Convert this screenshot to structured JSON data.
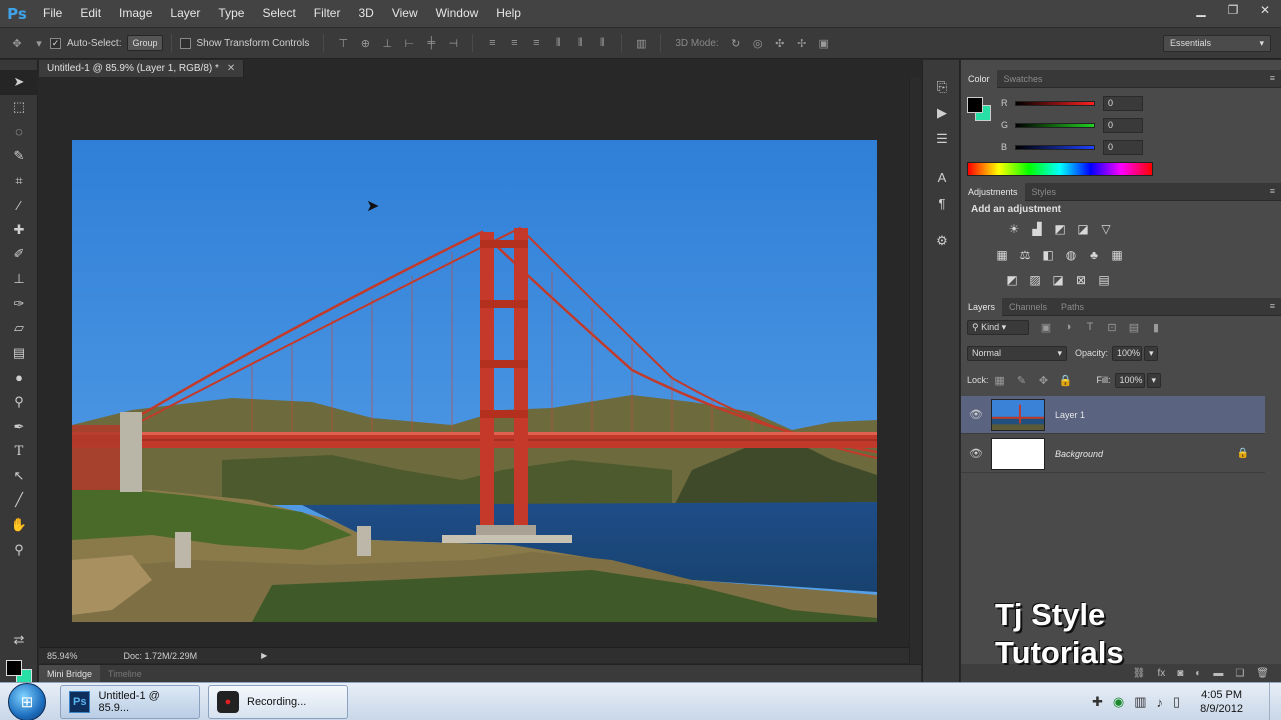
{
  "app": {
    "logo": "Ps"
  },
  "menu": [
    "File",
    "Edit",
    "Image",
    "Layer",
    "Type",
    "Select",
    "Filter",
    "3D",
    "View",
    "Window",
    "Help"
  ],
  "window_controls": {
    "minimize": "▁",
    "restore": "❐",
    "close": "✕"
  },
  "options": {
    "auto_select_label": "Auto-Select:",
    "auto_select_value": "Group",
    "show_transform_label": "Show Transform Controls",
    "mode_3d_label": "3D Mode:",
    "workspace": "Essentials"
  },
  "document": {
    "tab_title": "Untitled-1 @ 85.9% (Layer 1, RGB/8) *",
    "zoom": "85.94%",
    "doc_size": "Doc: 1.72M/2.29M"
  },
  "bottom_tabs": [
    "Mini Bridge",
    "Timeline"
  ],
  "color_panel": {
    "tabs": [
      "Color",
      "Swatches"
    ],
    "sliders": [
      {
        "label": "R",
        "value": "0",
        "gradient": "#ff2020"
      },
      {
        "label": "G",
        "value": "0",
        "gradient": "#20d020"
      },
      {
        "label": "B",
        "value": "0",
        "gradient": "#2040ff"
      }
    ],
    "foreground": "#000000",
    "background": "#28e0a6"
  },
  "adjustments_panel": {
    "tabs": [
      "Adjustments",
      "Styles"
    ],
    "title": "Add an adjustment"
  },
  "layers_panel": {
    "tabs": [
      "Layers",
      "Channels",
      "Paths"
    ],
    "filter": "Kind",
    "blend_mode": "Normal",
    "opacity_label": "Opacity:",
    "opacity": "100%",
    "lock_label": "Lock:",
    "fill_label": "Fill:",
    "fill": "100%",
    "layers": [
      {
        "name": "Layer 1",
        "selected": true
      },
      {
        "name": "Background",
        "selected": false
      }
    ]
  },
  "watermark": {
    "line1": "Tj Style",
    "line2": "Tutorials"
  },
  "taskbar": {
    "items": [
      {
        "icon": "Ps",
        "label": "Untitled-1 @ 85.9..."
      },
      {
        "icon": "●",
        "label": "Recording..."
      }
    ],
    "time": "4:05 PM",
    "date": "8/9/2012"
  }
}
